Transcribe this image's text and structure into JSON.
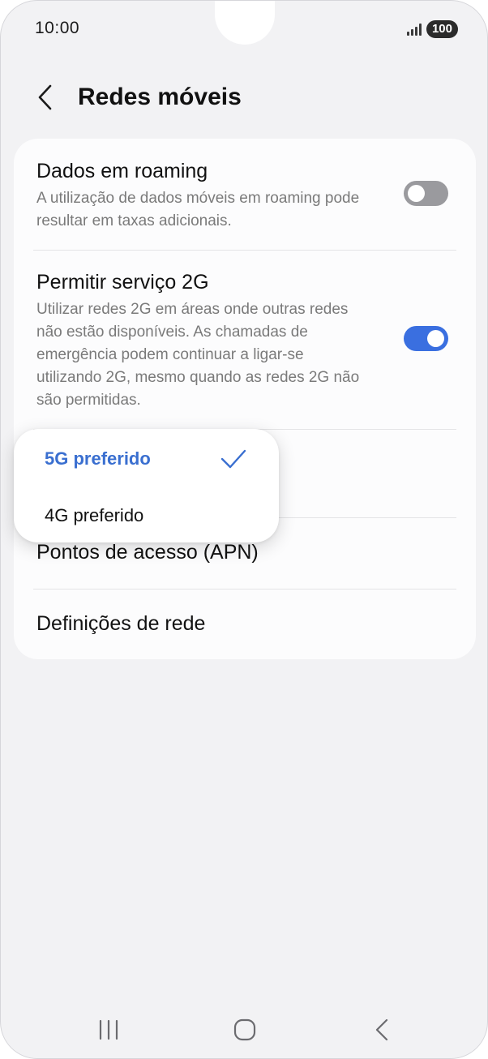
{
  "status_bar": {
    "time": "10:00",
    "battery": "100"
  },
  "header": {
    "title": "Redes móveis",
    "back_icon": "chevron-left-icon"
  },
  "settings": {
    "roaming": {
      "title": "Dados em roaming",
      "description": "A utilização de dados móveis em roaming pode resultar em taxas adicionais.",
      "enabled": false
    },
    "service_2g": {
      "title": "Permitir serviço 2G",
      "description": "Utilizar redes 2G em áreas onde outras redes não estão disponíveis. As chamadas de emergência podem continuar a ligar-se utilizando 2G, mesmo quando as redes 2G não são permitidas.",
      "enabled": true
    },
    "apn": {
      "title": "Pontos de acesso (APN)"
    },
    "network_settings": {
      "title": "Definições de rede"
    }
  },
  "network_mode_popup": {
    "options": [
      {
        "label": "5G preferido",
        "selected": true
      },
      {
        "label": "4G preferido",
        "selected": false
      }
    ]
  },
  "colors": {
    "accent": "#3a6fe0",
    "selected_text": "#3a6fd0",
    "toggle_off": "#9a9a9e",
    "background": "#f2f2f4"
  },
  "nav_bar": {
    "icons": [
      "recent-apps-icon",
      "home-icon",
      "back-icon"
    ]
  }
}
